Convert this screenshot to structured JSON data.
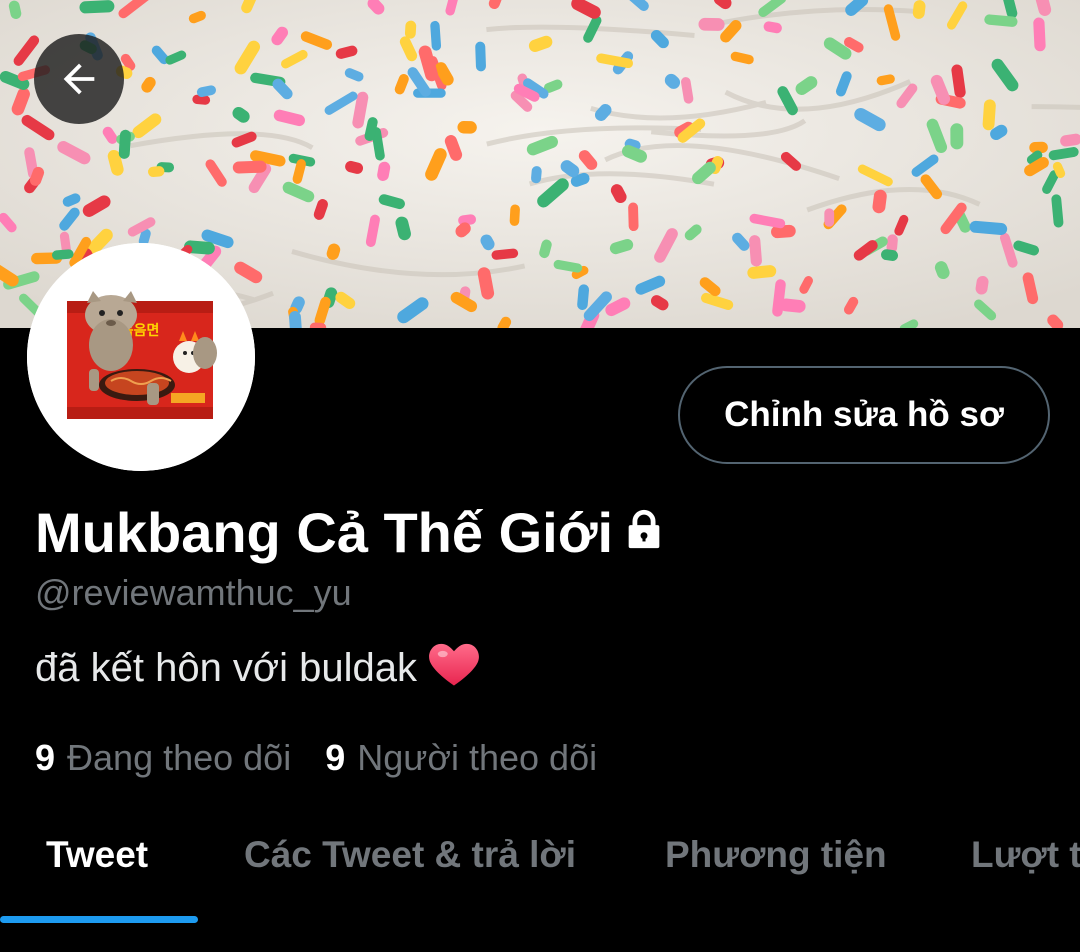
{
  "profile": {
    "display_name": "Mukbang Cả Thế Giới",
    "handle": "@reviewamthuc_yu",
    "bio": "đã kết hôn với buldak",
    "edit_button": "Chỉnh sửa hồ sơ"
  },
  "stats": {
    "following_count": "9",
    "following_label": "Đang theo dõi",
    "followers_count": "9",
    "followers_label": "Người theo dõi"
  },
  "tabs": [
    {
      "label": "Tweet",
      "active": true
    },
    {
      "label": "Các Tweet & trả lời",
      "active": false
    },
    {
      "label": "Phương tiện",
      "active": false
    },
    {
      "label": "Lượt thích",
      "active": false
    }
  ],
  "avatar_package_text": "붉닭볶음면",
  "icons": {
    "back": "arrow-left-icon",
    "lock": "lock-icon",
    "heart": "heart-icon"
  },
  "colors": {
    "accent": "#1d9bf0",
    "secondary_text": "#71767b",
    "background": "#000000"
  }
}
